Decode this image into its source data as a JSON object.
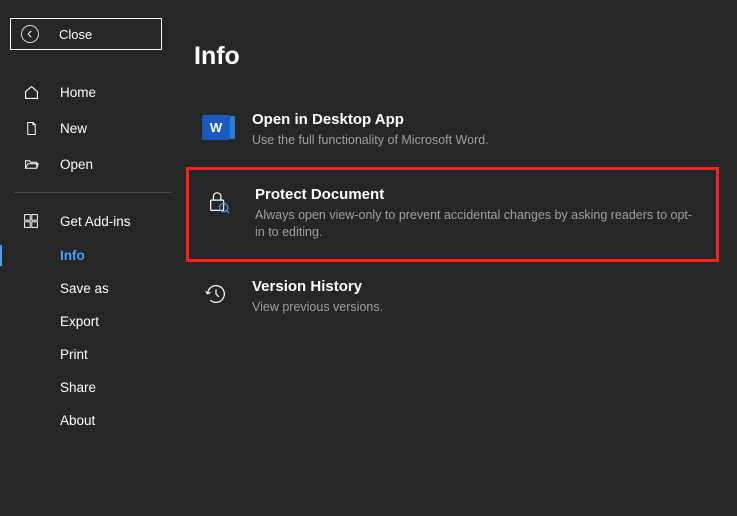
{
  "close": {
    "label": "Close"
  },
  "sidebar": {
    "primary": [
      {
        "label": "Home",
        "icon": "home"
      },
      {
        "label": "New",
        "icon": "new"
      },
      {
        "label": "Open",
        "icon": "open"
      }
    ],
    "secondary_icon": {
      "label": "Get Add-ins",
      "icon": "addins"
    },
    "secondary": [
      {
        "label": "Info",
        "active": true
      },
      {
        "label": "Save as"
      },
      {
        "label": "Export"
      },
      {
        "label": "Print"
      },
      {
        "label": "Share"
      },
      {
        "label": "About"
      }
    ]
  },
  "page": {
    "title": "Info"
  },
  "options": [
    {
      "title": "Open in Desktop App",
      "desc": "Use the full functionality of Microsoft Word.",
      "icon": "word"
    },
    {
      "title": "Protect Document",
      "desc": "Always open view-only to prevent accidental changes by asking readers to opt-in to editing.",
      "icon": "protect",
      "highlighted": true
    },
    {
      "title": "Version History",
      "desc": "View previous versions.",
      "icon": "history"
    }
  ]
}
